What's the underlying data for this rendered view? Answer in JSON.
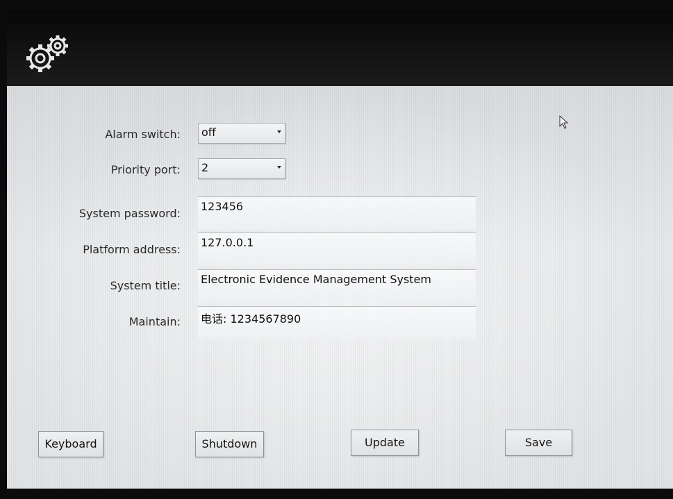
{
  "header": {
    "icon": "gears-icon"
  },
  "form": {
    "alarm_switch": {
      "label": "Alarm switch:",
      "value": "off"
    },
    "priority_port": {
      "label": "Priority port:",
      "value": "2"
    },
    "system_password": {
      "label": "System password:",
      "value": "123456"
    },
    "platform_address": {
      "label": "Platform address:",
      "value": "127.0.0.1"
    },
    "system_title": {
      "label": "System title:",
      "value": "Electronic Evidence Management System"
    },
    "maintain": {
      "label": "Maintain:",
      "value": "电话: 1234567890"
    }
  },
  "buttons": {
    "keyboard": "Keyboard",
    "shutdown": "Shutdown",
    "update": "Update",
    "save": "Save"
  },
  "colors": {
    "header_bg": "#0b0b0b",
    "panel_bg": "#e3e5e7",
    "text": "#2a2a2a"
  }
}
